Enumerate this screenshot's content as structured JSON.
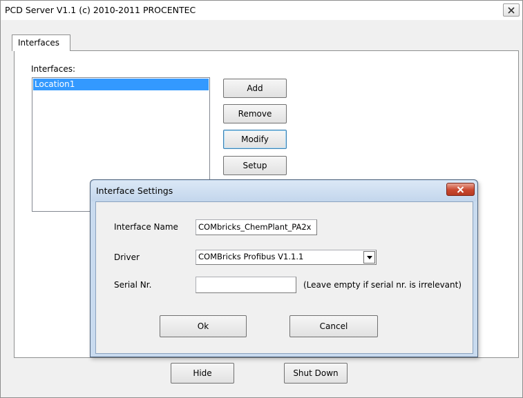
{
  "window": {
    "title": "PCD Server V1.1 (c) 2010-2011 PROCENTEC",
    "close_icon": "close-icon"
  },
  "tabs": [
    {
      "label": "Interfaces",
      "active": true
    }
  ],
  "interfaces_panel": {
    "label": "Interfaces:",
    "items": [
      "Location1"
    ],
    "selected_index": 0,
    "buttons": {
      "add": "Add",
      "remove": "Remove",
      "modify": "Modify",
      "setup": "Setup"
    }
  },
  "footer": {
    "hide": "Hide",
    "shut_down": "Shut Down"
  },
  "dialog": {
    "title": "Interface Settings",
    "close_icon": "close-icon",
    "interface_name_label": "Interface Name",
    "interface_name_value": "COMbricks_ChemPlant_PA2x",
    "driver_label": "Driver",
    "driver_value": "COMBricks Profibus V1.1.1",
    "serial_label": "Serial Nr.",
    "serial_value": "",
    "serial_hint": "(Leave empty if serial nr. is irrelevant)",
    "ok": "Ok",
    "cancel": "Cancel"
  },
  "colors": {
    "selection": "#3399ff",
    "dialog_frame": "#c9dbef",
    "close_button_red": "#c9482f"
  }
}
